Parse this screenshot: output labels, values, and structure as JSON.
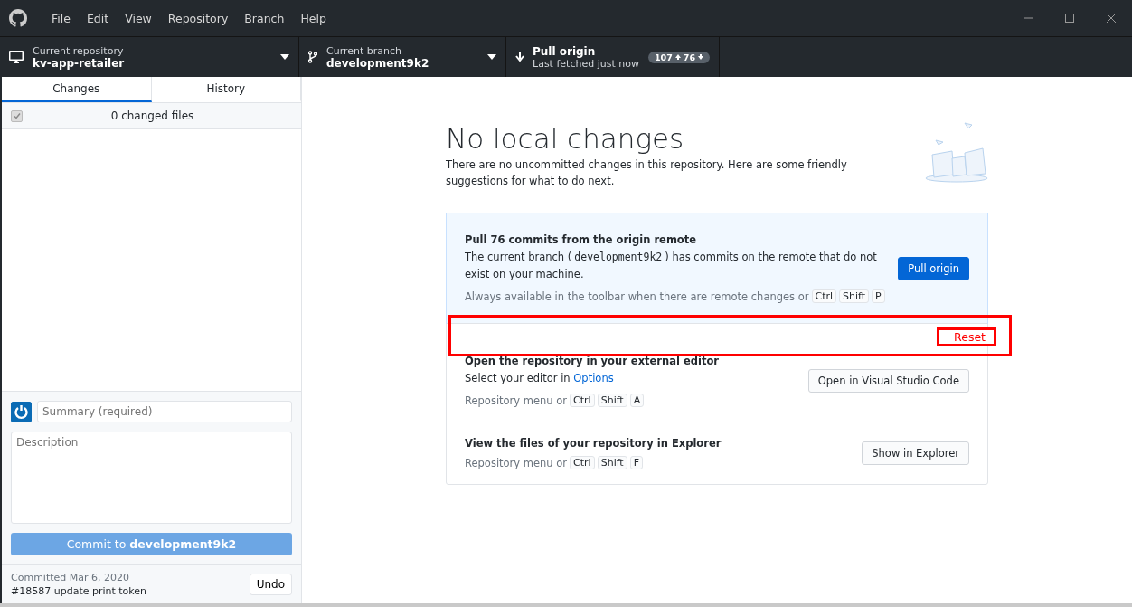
{
  "menu": [
    "File",
    "Edit",
    "View",
    "Repository",
    "Branch",
    "Help"
  ],
  "toolbar": {
    "repository": {
      "label": "Current repository",
      "value": "kv-app-retailer"
    },
    "branch": {
      "label": "Current branch",
      "value": "development9k2"
    },
    "pull": {
      "title": "Pull origin",
      "subtitle": "Last fetched just now",
      "ahead": "107",
      "behind": "76"
    }
  },
  "tabs": [
    {
      "label": "Changes",
      "selected": true
    },
    {
      "label": "History",
      "selected": false
    }
  ],
  "changes": {
    "checked": true,
    "label": "0 changed files"
  },
  "commit": {
    "summary_placeholder": "Summary (required)",
    "description_placeholder": "Description",
    "button": "Commit to **development9k2**"
  },
  "last_commit": {
    "date": "Committed Mar 6, 2020",
    "message": "#18587 update print token",
    "undo": "Undo"
  },
  "main": {
    "title": "No local changes",
    "description": "There are no uncommitted changes in this repository. Here are some friendly suggestions for what to do next.",
    "suggestions": [
      {
        "kind": "highlighted",
        "title": "Pull 76 commits from the origin remote",
        "text": [
          {
            "kind": "text",
            "text": "The current branch ("
          },
          {
            "kind": "code",
            "text": "development9k2"
          },
          {
            "kind": "text",
            "text": ") has commits on the remote that do not exist on your machine."
          }
        ],
        "hint": "Always available in the toolbar when there are remote changes or",
        "keys": [
          "Ctrl",
          "Shift",
          "P"
        ],
        "button": "Pull origin"
      },
      {
        "kind": "plain",
        "title": "Open the repository in your external editor",
        "text": [
          {
            "kind": "text",
            "text": "Select your editor in "
          },
          {
            "kind": "link",
            "text": "Options"
          }
        ],
        "hint": "Repository menu or",
        "keys": [
          "Ctrl",
          "Shift",
          "A"
        ],
        "button": "Open in Visual Studio Code"
      },
      {
        "kind": "plain",
        "title": "View the files of your repository in Explorer",
        "hint": "Repository menu or",
        "keys": [
          "Ctrl",
          "Shift",
          "F"
        ],
        "button": "Show in Explorer"
      }
    ]
  },
  "annotation": {
    "label": "Reset"
  }
}
